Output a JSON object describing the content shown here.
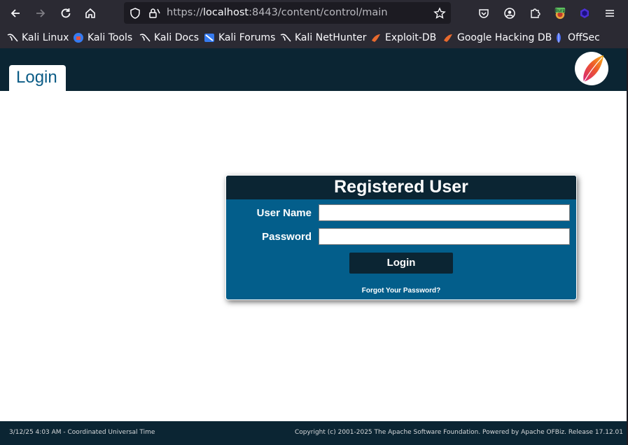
{
  "browser": {
    "url_prefix": "https://",
    "url_host": "localhost",
    "url_rest": ":8443/content/control/main",
    "bookmarks": [
      {
        "label": "Kali Linux",
        "icon": "kali-dragon-icon"
      },
      {
        "label": "Kali Tools",
        "icon": "kali-tools-icon"
      },
      {
        "label": "Kali Docs",
        "icon": "kali-dragon-icon"
      },
      {
        "label": "Kali Forums",
        "icon": "kali-forums-icon"
      },
      {
        "label": "Kali NetHunter",
        "icon": "kali-dragon-icon"
      },
      {
        "label": "Exploit-DB",
        "icon": "exploit-db-icon"
      },
      {
        "label": "Google Hacking DB",
        "icon": "exploit-db-icon"
      },
      {
        "label": "OffSec",
        "icon": "offsec-icon"
      }
    ],
    "extension_badge": "Burp"
  },
  "header": {
    "tab_label": "Login"
  },
  "login_panel": {
    "title": "Registered User",
    "username_label": "User Name",
    "username_value": "",
    "password_label": "Password",
    "password_value": "",
    "login_button": "Login",
    "forgot_link": "Forgot Your Password?"
  },
  "footer": {
    "timestamp": "3/12/25 4:03 AM - Coordinated Universal Time",
    "copyright": "Copyright (c) 2001-2025 The Apache Software Foundation. Powered by Apache OFBiz. Release 17.12.01"
  },
  "colors": {
    "header_bg": "#0b2533",
    "panel_bg": "#035e8b",
    "tab_text": "#0b5c86"
  }
}
